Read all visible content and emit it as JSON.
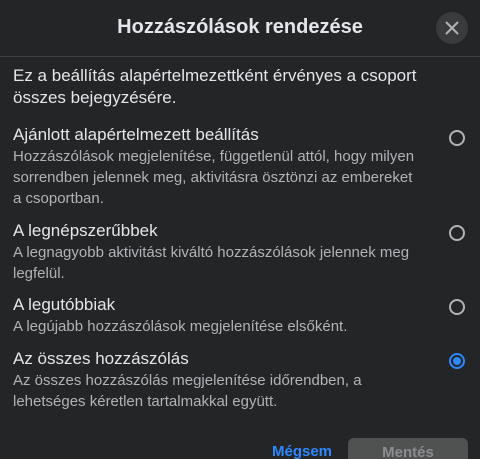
{
  "dialog": {
    "title": "Hozzászólások rendezése",
    "close_icon": "close-icon",
    "intro": "Ez a beállítás alapértelmezettként érvényes a csoport összes bejegyzésére."
  },
  "options": [
    {
      "title": "Ajánlott alapértelmezett beállítás",
      "description": "Hozzászólások megjelenítése, függetlenül attól, hogy milyen sorrendben jelennek meg, aktivitásra ösztönzi az embereket a csoportban.",
      "selected": false
    },
    {
      "title": "A legnépszerűbbek",
      "description": "A legnagyobb aktivitást kiváltó hozzászólások jelennek meg legfelül.",
      "selected": false
    },
    {
      "title": "A legutóbbiak",
      "description": "A legújabb hozzászólások megjelenítése elsőként.",
      "selected": false
    },
    {
      "title": "Az összes hozzászólás",
      "description": "Az összes hozzászólás megjelenítése időrendben, a lehetséges kéretlen tartalmakkal együtt.",
      "selected": true
    }
  ],
  "footer": {
    "cancel_label": "Mégsem",
    "save_label": "Mentés"
  },
  "colors": {
    "background": "#242526",
    "accent": "#2d88ff",
    "text_primary": "#e4e6eb",
    "text_secondary": "#b0b3b8"
  }
}
